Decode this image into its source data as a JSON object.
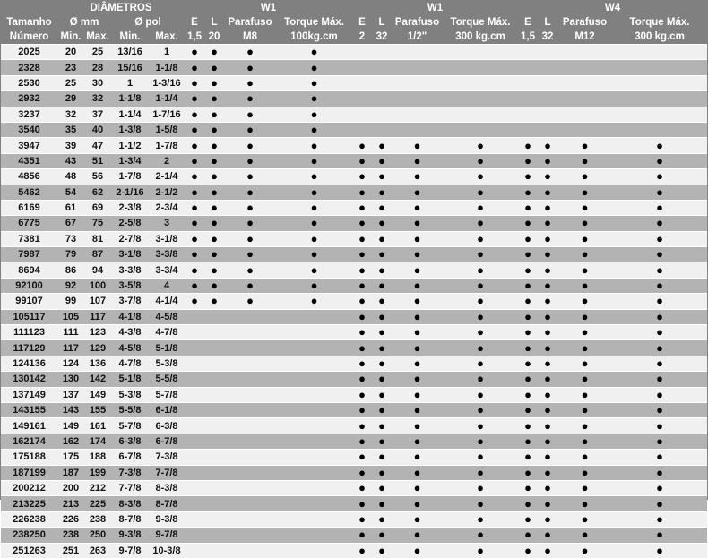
{
  "header": {
    "diametros": "DIÂMETROS",
    "tamanho": "Tamanho",
    "numero": "Número",
    "mm": "Ø mm",
    "pol": "Ø pol",
    "min": "Min.",
    "max": "Max.",
    "groups": [
      {
        "title": "W1",
        "e": "E",
        "l": "L",
        "e_val": "1,5",
        "l_val": "20",
        "parafuso": "Parafuso",
        "parafuso_val": "M8",
        "torque": "Torque Máx.",
        "torque_val": "100kg.cm"
      },
      {
        "title": "W1",
        "e": "E",
        "l": "L",
        "e_val": "2",
        "l_val": "32",
        "parafuso": "Parafuso",
        "parafuso_val": "1/2\"",
        "torque": "Torque Máx.",
        "torque_val": "300 kg.cm"
      },
      {
        "title": "W4",
        "e": "E",
        "l": "L",
        "e_val": "1,5",
        "l_val": "32",
        "parafuso": "Parafuso",
        "parafuso_val": "M12",
        "torque": "Torque Máx.",
        "torque_val": "300 kg.cm"
      }
    ]
  },
  "dot_symbol": "●",
  "rows": [
    {
      "size": "2025",
      "mm_min": "20",
      "mm_max": "25",
      "pol_min": "13/16",
      "pol_max": "1",
      "g1": true,
      "g2": false,
      "g3": false
    },
    {
      "size": "2328",
      "mm_min": "23",
      "mm_max": "28",
      "pol_min": "15/16",
      "pol_max": "1-1/8",
      "g1": true,
      "g2": false,
      "g3": false
    },
    {
      "size": "2530",
      "mm_min": "25",
      "mm_max": "30",
      "pol_min": "1",
      "pol_max": "1-3/16",
      "g1": true,
      "g2": false,
      "g3": false
    },
    {
      "size": "2932",
      "mm_min": "29",
      "mm_max": "32",
      "pol_min": "1-1/8",
      "pol_max": "1-1/4",
      "g1": true,
      "g2": false,
      "g3": false
    },
    {
      "size": "3237",
      "mm_min": "32",
      "mm_max": "37",
      "pol_min": "1-1/4",
      "pol_max": "1-7/16",
      "g1": true,
      "g2": false,
      "g3": false
    },
    {
      "size": "3540",
      "mm_min": "35",
      "mm_max": "40",
      "pol_min": "1-3/8",
      "pol_max": "1-5/8",
      "g1": true,
      "g2": false,
      "g3": false
    },
    {
      "size": "3947",
      "mm_min": "39",
      "mm_max": "47",
      "pol_min": "1-1/2",
      "pol_max": "1-7/8",
      "g1": true,
      "g2": true,
      "g3": true
    },
    {
      "size": "4351",
      "mm_min": "43",
      "mm_max": "51",
      "pol_min": "1-3/4",
      "pol_max": "2",
      "g1": true,
      "g2": true,
      "g3": true
    },
    {
      "size": "4856",
      "mm_min": "48",
      "mm_max": "56",
      "pol_min": "1-7/8",
      "pol_max": "2-1/4",
      "g1": true,
      "g2": true,
      "g3": true
    },
    {
      "size": "5462",
      "mm_min": "54",
      "mm_max": "62",
      "pol_min": "2-1/16",
      "pol_max": "2-1/2",
      "g1": true,
      "g2": true,
      "g3": true
    },
    {
      "size": "6169",
      "mm_min": "61",
      "mm_max": "69",
      "pol_min": "2-3/8",
      "pol_max": "2-3/4",
      "g1": true,
      "g2": true,
      "g3": true
    },
    {
      "size": "6775",
      "mm_min": "67",
      "mm_max": "75",
      "pol_min": "2-5/8",
      "pol_max": "3",
      "g1": true,
      "g2": true,
      "g3": true
    },
    {
      "size": "7381",
      "mm_min": "73",
      "mm_max": "81",
      "pol_min": "2-7/8",
      "pol_max": "3-1/8",
      "g1": true,
      "g2": true,
      "g3": true
    },
    {
      "size": "7987",
      "mm_min": "79",
      "mm_max": "87",
      "pol_min": "3-1/8",
      "pol_max": "3-3/8",
      "g1": true,
      "g2": true,
      "g3": true
    },
    {
      "size": "8694",
      "mm_min": "86",
      "mm_max": "94",
      "pol_min": "3-3/8",
      "pol_max": "3-3/4",
      "g1": true,
      "g2": true,
      "g3": true
    },
    {
      "size": "92100",
      "mm_min": "92",
      "mm_max": "100",
      "pol_min": "3-5/8",
      "pol_max": "4",
      "g1": true,
      "g2": true,
      "g3": true
    },
    {
      "size": "99107",
      "mm_min": "99",
      "mm_max": "107",
      "pol_min": "3-7/8",
      "pol_max": "4-1/4",
      "g1": true,
      "g2": true,
      "g3": true
    },
    {
      "size": "105117",
      "mm_min": "105",
      "mm_max": "117",
      "pol_min": "4-1/8",
      "pol_max": "4-5/8",
      "g1": false,
      "g2": true,
      "g3": true
    },
    {
      "size": "111123",
      "mm_min": "111",
      "mm_max": "123",
      "pol_min": "4-3/8",
      "pol_max": "4-7/8",
      "g1": false,
      "g2": true,
      "g3": true
    },
    {
      "size": "117129",
      "mm_min": "117",
      "mm_max": "129",
      "pol_min": "4-5/8",
      "pol_max": "5-1/8",
      "g1": false,
      "g2": true,
      "g3": true
    },
    {
      "size": "124136",
      "mm_min": "124",
      "mm_max": "136",
      "pol_min": "4-7/8",
      "pol_max": "5-3/8",
      "g1": false,
      "g2": true,
      "g3": true
    },
    {
      "size": "130142",
      "mm_min": "130",
      "mm_max": "142",
      "pol_min": "5-1/8",
      "pol_max": "5-5/8",
      "g1": false,
      "g2": true,
      "g3": true
    },
    {
      "size": "137149",
      "mm_min": "137",
      "mm_max": "149",
      "pol_min": "5-3/8",
      "pol_max": "5-7/8",
      "g1": false,
      "g2": true,
      "g3": true
    },
    {
      "size": "143155",
      "mm_min": "143",
      "mm_max": "155",
      "pol_min": "5-5/8",
      "pol_max": "6-1/8",
      "g1": false,
      "g2": true,
      "g3": true
    },
    {
      "size": "149161",
      "mm_min": "149",
      "mm_max": "161",
      "pol_min": "5-7/8",
      "pol_max": "6-3/8",
      "g1": false,
      "g2": true,
      "g3": true
    },
    {
      "size": "162174",
      "mm_min": "162",
      "mm_max": "174",
      "pol_min": "6-3/8",
      "pol_max": "6-7/8",
      "g1": false,
      "g2": true,
      "g3": true
    },
    {
      "size": "175188",
      "mm_min": "175",
      "mm_max": "188",
      "pol_min": "6-7/8",
      "pol_max": "7-3/8",
      "g1": false,
      "g2": true,
      "g3": true
    },
    {
      "size": "187199",
      "mm_min": "187",
      "mm_max": "199",
      "pol_min": "7-3/8",
      "pol_max": "7-7/8",
      "g1": false,
      "g2": true,
      "g3": true
    },
    {
      "size": "200212",
      "mm_min": "200",
      "mm_max": "212",
      "pol_min": "7-7/8",
      "pol_max": "8-3/8",
      "g1": false,
      "g2": true,
      "g3": true
    },
    {
      "size": "213225",
      "mm_min": "213",
      "mm_max": "225",
      "pol_min": "8-3/8",
      "pol_max": "8-7/8",
      "g1": false,
      "g2": true,
      "g3": true
    },
    {
      "size": "226238",
      "mm_min": "226",
      "mm_max": "238",
      "pol_min": "8-7/8",
      "pol_max": "9-3/8",
      "g1": false,
      "g2": true,
      "g3": true
    },
    {
      "size": "238250",
      "mm_min": "238",
      "mm_max": "250",
      "pol_min": "9-3/8",
      "pol_max": "9-7/8",
      "g1": false,
      "g2": true,
      "g3": true
    },
    {
      "size": "251263",
      "mm_min": "251",
      "mm_max": "263",
      "pol_min": "9-7/8",
      "pol_max": "10-3/8",
      "g1": false,
      "g2": true,
      "g3": true
    }
  ]
}
